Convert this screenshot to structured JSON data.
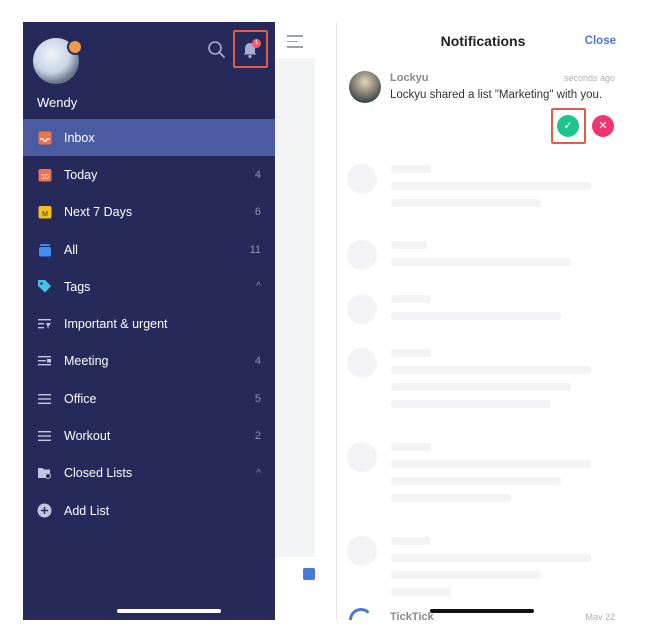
{
  "sidebar": {
    "username": "Wendy",
    "avatar_badge_color": "#f29b4b",
    "bell_badge_count": "1",
    "items": [
      {
        "label": "Inbox",
        "count": "",
        "icon": "inbox-icon",
        "active": true
      },
      {
        "label": "Today",
        "count": "4",
        "icon": "calendar-today-icon"
      },
      {
        "label": "Next 7 Days",
        "count": "6",
        "icon": "calendar-week-icon"
      },
      {
        "label": "All",
        "count": "11",
        "icon": "stack-icon"
      },
      {
        "label": "Tags",
        "count": "",
        "icon": "tag-icon",
        "caret": "^"
      },
      {
        "label": "Important & urgent",
        "count": "",
        "icon": "filter-list-icon"
      },
      {
        "label": "Meeting",
        "count": "4",
        "icon": "list-icon"
      },
      {
        "label": "Office",
        "count": "5",
        "icon": "list-icon"
      },
      {
        "label": "Workout",
        "count": "2",
        "icon": "list-icon"
      },
      {
        "label": "Closed Lists",
        "count": "",
        "icon": "folder-icon",
        "caret": "^"
      },
      {
        "label": "Add List",
        "count": "",
        "icon": "plus-circle-icon"
      }
    ]
  },
  "notifications": {
    "title": "Notifications",
    "close_label": "Close",
    "first": {
      "name": "Lockyu",
      "time": "seconds ago",
      "message": "Lockyu shared a list \"Marketing\" with you."
    },
    "last": {
      "name": "TickTick",
      "date": "May 22"
    }
  },
  "colors": {
    "sidebar_bg": "#252a5a",
    "active_item": "#4a5ba1",
    "accept": "#1ec48f",
    "reject": "#f2356f",
    "link": "#4a78d8",
    "highlight": "#e25b4b"
  }
}
